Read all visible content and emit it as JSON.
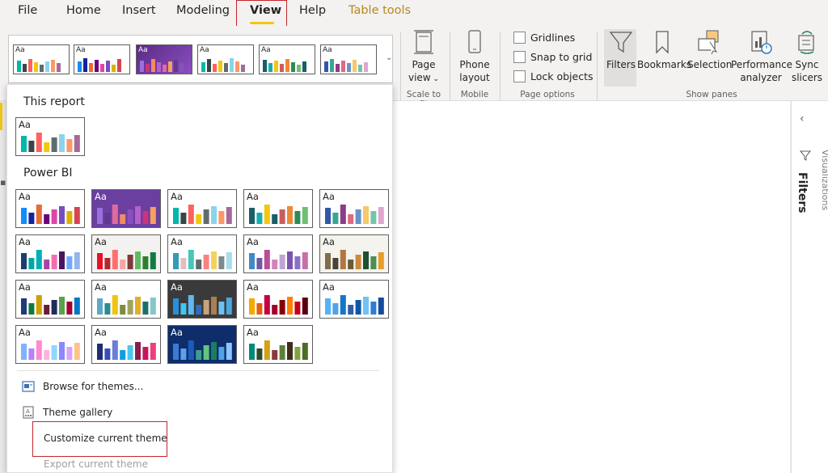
{
  "menu": {
    "tabs": [
      {
        "label": "File"
      },
      {
        "label": "Home"
      },
      {
        "label": "Insert"
      },
      {
        "label": "Modeling"
      },
      {
        "label": "View"
      },
      {
        "label": "Help"
      },
      {
        "label": "Table tools"
      }
    ],
    "active": "View"
  },
  "ribbon": {
    "page_view": {
      "line1": "Page",
      "line2": "view"
    },
    "phone_layout": {
      "line1": "Phone",
      "line2": "layout"
    },
    "scale_to_fit_label": "Scale to fit",
    "mobile_label": "Mobile",
    "page_options": {
      "gridlines": "Gridlines",
      "snap_to_grid": "Snap to grid",
      "lock_objects": "Lock objects",
      "group_label": "Page options"
    },
    "show_panes": {
      "filters": "Filters",
      "bookmarks": "Bookmarks",
      "selection": "Selection",
      "performance": {
        "line1": "Performance",
        "line2": "analyzer"
      },
      "sync": {
        "line1": "Sync",
        "line2": "slicers"
      },
      "group_label": "Show panes"
    }
  },
  "right_pane": {
    "filters_label": "Filters",
    "visualizations_label": "Visualizations"
  },
  "dropdown": {
    "this_report_label": "This report",
    "power_bi_label": "Power BI",
    "thumb_label": "Aa",
    "items": {
      "browse": "Browse for themes...",
      "gallery": "Theme gallery",
      "customize": "Customize current theme",
      "export": "Export current theme"
    }
  },
  "theme_palettes": {
    "report": [
      "#01b8aa",
      "#374649",
      "#fd625e",
      "#f2c80f",
      "#5f6b6d",
      "#8ad4eb",
      "#fe9666",
      "#a66999"
    ],
    "power_bi": [
      {
        "bg": "#ffffff",
        "colors": [
          "#118dff",
          "#12239e",
          "#e66c37",
          "#6b007b",
          "#e044a7",
          "#744ec2",
          "#d9b300",
          "#d64550"
        ]
      },
      {
        "bg": "#6b3fa0",
        "colors": [
          "#9b6fdd",
          "#5e3a8c",
          "#e06b9b",
          "#f28b62",
          "#8a4fbf",
          "#b65fcf",
          "#c8357b",
          "#f4a261"
        ]
      },
      {
        "bg": "#ffffff",
        "colors": [
          "#01b8aa",
          "#374649",
          "#fd625e",
          "#f2c80f",
          "#5f6b6d",
          "#8ad4eb",
          "#fe9666",
          "#a66999"
        ]
      },
      {
        "bg": "#ffffff",
        "colors": [
          "#1a5e66",
          "#15aeae",
          "#f2c80f",
          "#1a5e66",
          "#cd5c5c",
          "#ed8936",
          "#2e8b57",
          "#6fbf73"
        ]
      },
      {
        "bg": "#ffffff",
        "colors": [
          "#3257a8",
          "#37a794",
          "#8b3d88",
          "#dd6b7f",
          "#6b91c9",
          "#f5c869",
          "#77c4a8",
          "#dea6cf"
        ]
      },
      {
        "bg": "#ffffff",
        "colors": [
          "#1a3f6f",
          "#00a89e",
          "#00b0b9",
          "#a745a4",
          "#f36eb0",
          "#48165e",
          "#6ea8ff",
          "#94b5ea"
        ]
      },
      {
        "bg": "#f3f2f1",
        "colors": [
          "#e81123",
          "#b3272d",
          "#ff6f6f",
          "#f4a5a5",
          "#7f3b3b",
          "#5dbb63",
          "#2e7d32",
          "#107c41"
        ]
      },
      {
        "bg": "#ffffff",
        "colors": [
          "#3599b8",
          "#dfbfbf",
          "#4ac5bb",
          "#5f6b6d",
          "#fb8281",
          "#f4d25a",
          "#7f898a",
          "#a4ddee"
        ]
      },
      {
        "bg": "#ffffff",
        "colors": [
          "#3f8ac8",
          "#6f5aa2",
          "#bb4d96",
          "#cf86b7",
          "#c1a3d7",
          "#7b53ae",
          "#8d6fc8",
          "#c96fa6"
        ]
      },
      {
        "bg": "#f5f3ee",
        "colors": [
          "#7f6d4b",
          "#46433c",
          "#b27642",
          "#6b5a37",
          "#ca8a3e",
          "#1e5131",
          "#4b8e52",
          "#e79e29"
        ]
      },
      {
        "bg": "#ffffff",
        "colors": [
          "#1e3a78",
          "#0f7a3d",
          "#d1a000",
          "#6d1a36",
          "#1b2e5a",
          "#58a34a",
          "#a10034",
          "#0077c8"
        ]
      },
      {
        "bg": "#ffffff",
        "colors": [
          "#5aa9c9",
          "#2b8d8c",
          "#f1c40f",
          "#7f8c41",
          "#a0a35e",
          "#e3ad2d",
          "#1c6e6c",
          "#87c6c8"
        ]
      },
      {
        "bg": "#3a3a3a",
        "colors": [
          "#2a8fd8",
          "#3ec8f0",
          "#5fb9ef",
          "#2c6ebd",
          "#c9a47a",
          "#aa7f4f",
          "#6dc1f0",
          "#4ba7e1"
        ]
      },
      {
        "bg": "#ffffff",
        "colors": [
          "#f7a800",
          "#e25e12",
          "#c5003e",
          "#a0002a",
          "#870000",
          "#ff7f00",
          "#c40019",
          "#59000f"
        ]
      },
      {
        "bg": "#ffffff",
        "colors": [
          "#50b6f8",
          "#52a2e4",
          "#1675c8",
          "#2f5ea8",
          "#0c57a9",
          "#6ec3f4",
          "#2d7ed1",
          "#154b9b"
        ]
      },
      {
        "bg": "#ffffff",
        "colors": [
          "#7eb3ff",
          "#b482ff",
          "#ff8ad1",
          "#ffb3d8",
          "#90d7ff",
          "#8a87ff",
          "#d8a4ff",
          "#ffc38a"
        ]
      },
      {
        "bg": "#ffffff",
        "colors": [
          "#1f2d73",
          "#3a4cba",
          "#6b7fd8",
          "#0c9ee0",
          "#4cc6ef",
          "#8d1c4c",
          "#c2185b",
          "#ec407a"
        ]
      },
      {
        "bg": "#0f2d6b",
        "colors": [
          "#3a7bd5",
          "#5aa2ef",
          "#1e5bb8",
          "#3aa08c",
          "#62c77a",
          "#1a7e5c",
          "#4fa3e6",
          "#8ec5ff"
        ]
      },
      {
        "bg": "#ffffff",
        "colors": [
          "#00897b",
          "#2e4a2b",
          "#d4a017",
          "#8b3a3a",
          "#5f7f3b",
          "#3e2d1c",
          "#80a53a",
          "#4e6b2a"
        ]
      }
    ]
  }
}
